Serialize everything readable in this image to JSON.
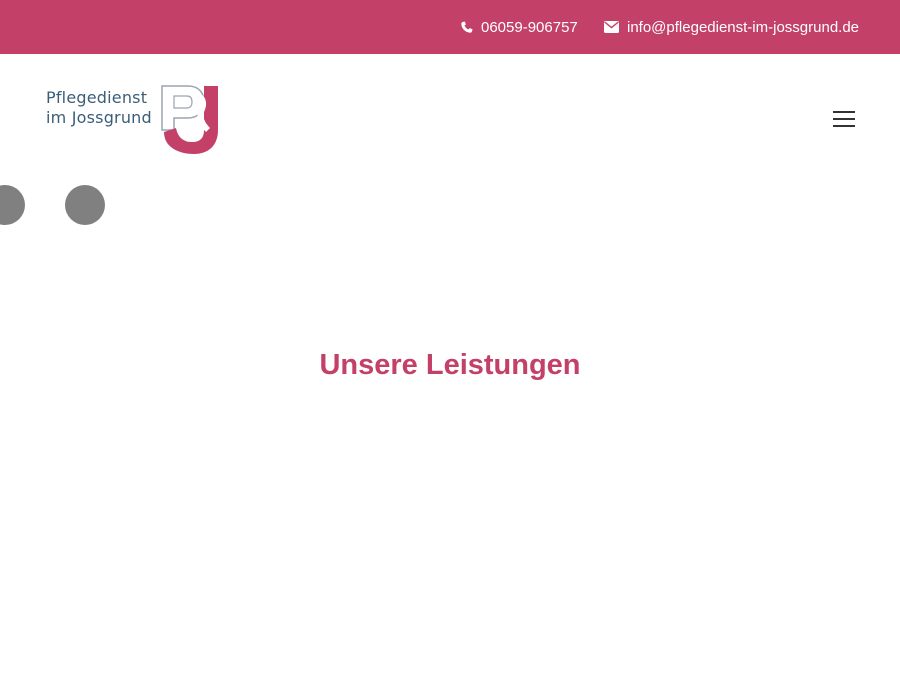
{
  "topbar": {
    "phone": "06059-906757",
    "email": "info@pflegedienst-im-jossgrund.de",
    "phone_icon": "phone-icon",
    "email_icon": "envelope-icon"
  },
  "logo": {
    "line1": "Pflegedienst",
    "line2": "im Jossgrund",
    "mark": "PJ"
  },
  "nav": {
    "menu_icon": "hamburger-menu-icon"
  },
  "main": {
    "title": "Unsere Leistungen"
  },
  "colors": {
    "brand": "#c34168",
    "logo_blue": "#3b5e78",
    "dot": "#808080"
  }
}
